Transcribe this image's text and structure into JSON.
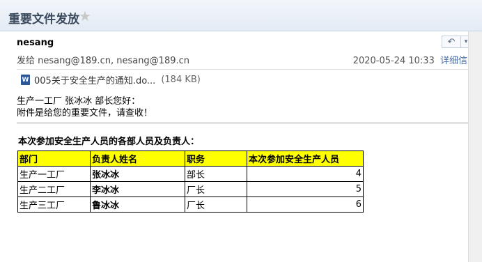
{
  "window": {
    "title": "重要文件发放",
    "star_glyph": "★"
  },
  "toolbar": {
    "reply_glyph": "↶",
    "more_glyph": "▾"
  },
  "message": {
    "sender_name": "nesang",
    "to_label": "发给",
    "recipients": "nesang@189.cn, nesang@189.cn",
    "date": "2020-05-24 10:33",
    "details_link": "详细信息",
    "attachment": {
      "name": "005关于安全生产的通知.do...",
      "size": "(184 KB)",
      "icon": "word-doc-icon",
      "icon_glyph": "W"
    },
    "greeting": "生产一工厂 张冰冰 部长您好：",
    "line2": "附件是给您的重要文件，请查收！",
    "table_title": "本次参加安全生产人员的各部人员及负责人："
  },
  "table": {
    "headers": [
      "部门",
      "负责人姓名",
      "职务",
      "本次参加安全生产人员"
    ],
    "rows": [
      [
        "生产一工厂",
        "张冰冰",
        "部长",
        "4"
      ],
      [
        "生产二工厂",
        "李冰冰",
        "厂长",
        "5"
      ],
      [
        "生产三工厂",
        "鲁冰冰",
        "厂长",
        "6"
      ]
    ]
  },
  "colors": {
    "header_bg": "#ffff00",
    "link": "#4a6fa5"
  }
}
